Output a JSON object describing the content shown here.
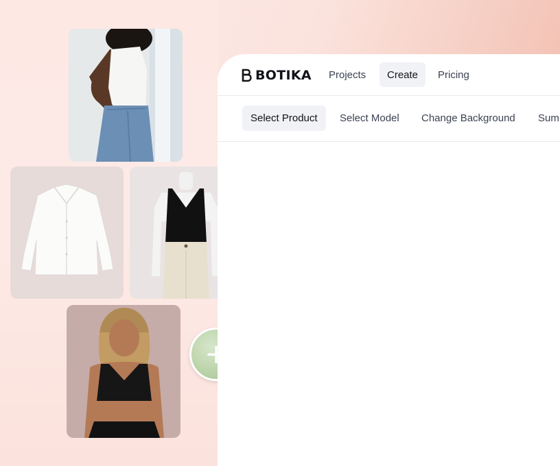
{
  "brand": {
    "name": "BOTIKA"
  },
  "nav": {
    "items": [
      {
        "label": "Projects"
      },
      {
        "label": "Create"
      },
      {
        "label": "Pricing"
      }
    ],
    "active": "Create"
  },
  "steps": {
    "items": [
      {
        "label": "Select Product"
      },
      {
        "label": "Select Model"
      },
      {
        "label": "Change Background"
      },
      {
        "label": "Sum"
      }
    ],
    "active": "Select Product"
  },
  "add_button": {
    "label": "+"
  },
  "gallery": [
    {
      "name": "model-white-bodysuit-jeans-photo"
    },
    {
      "name": "white-shirt-product-photo"
    },
    {
      "name": "black-tank-mannequin-photo"
    },
    {
      "name": "model-black-crop-top-photo"
    }
  ]
}
